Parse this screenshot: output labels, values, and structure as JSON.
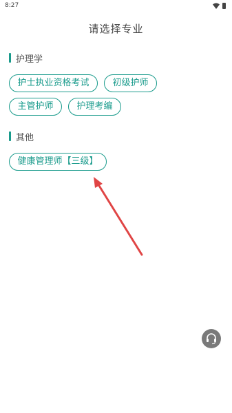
{
  "status_bar": {
    "time": "8:27"
  },
  "header": {
    "title": "请选择专业"
  },
  "sections": [
    {
      "title": "护理学",
      "options": [
        "护士执业资格考试",
        "初级护师",
        "主管护师",
        "护理考编"
      ]
    },
    {
      "title": "其他",
      "options": [
        "健康管理师【三级】"
      ]
    }
  ],
  "icons": {
    "wifi": "wifi-icon",
    "battery": "battery-icon",
    "support": "headset-icon"
  },
  "colors": {
    "accent": "#1a9b8c",
    "annotation_arrow": "#e04545"
  }
}
